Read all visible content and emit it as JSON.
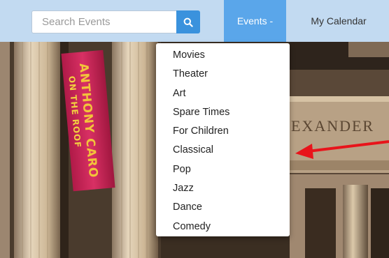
{
  "header": {
    "search": {
      "placeholder": "Search Events",
      "value": ""
    },
    "search_button_icon": "search-icon",
    "nav": {
      "events_label": "Events -",
      "calendar_label": "My Calendar"
    }
  },
  "hero": {
    "banner_line1": "ANTHONY CARO",
    "banner_line2": "ON THE ROOF",
    "facade_text": "EXANDER"
  },
  "dropdown": {
    "items": [
      "Movies",
      "Theater",
      "Art",
      "Spare Times",
      "For Children",
      "Classical",
      "Pop",
      "Jazz",
      "Dance",
      "Comedy"
    ]
  },
  "colors": {
    "navbar": "#c2daf1",
    "active_tab": "#5aa6ea",
    "search_button": "#3a92dd",
    "arrow": "#e8141b"
  }
}
